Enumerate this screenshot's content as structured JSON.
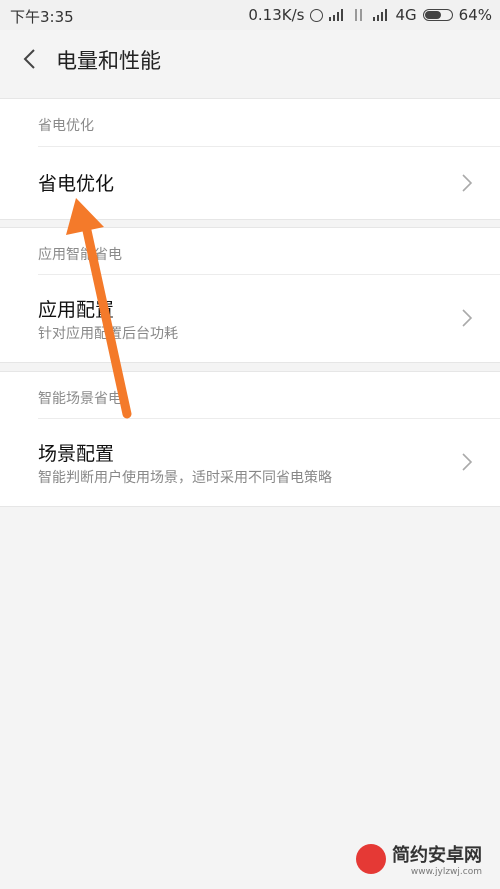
{
  "status_bar": {
    "time": "下午3:35",
    "network_speed": "0.13K/s",
    "network_type": "4G",
    "battery": "64%",
    "battery_level": 0.64
  },
  "header": {
    "title": "电量和性能",
    "back_icon": "chevron-left-icon"
  },
  "sections": [
    {
      "header": "省电优化",
      "items": [
        {
          "title": "省电优化",
          "subtitle": ""
        }
      ]
    },
    {
      "header": "应用智能省电",
      "items": [
        {
          "title": "应用配置",
          "subtitle": "针对应用配置后台功耗"
        }
      ]
    },
    {
      "header": "智能场景省电",
      "items": [
        {
          "title": "场景配置",
          "subtitle": "智能判断用户使用场景，适时采用不同省电策略"
        }
      ]
    }
  ],
  "annotation": {
    "color": "#f47a2a",
    "icon": "arrow-up-icon"
  },
  "watermark": {
    "text": "简约安卓网",
    "url": "www.jylzwj.com"
  }
}
